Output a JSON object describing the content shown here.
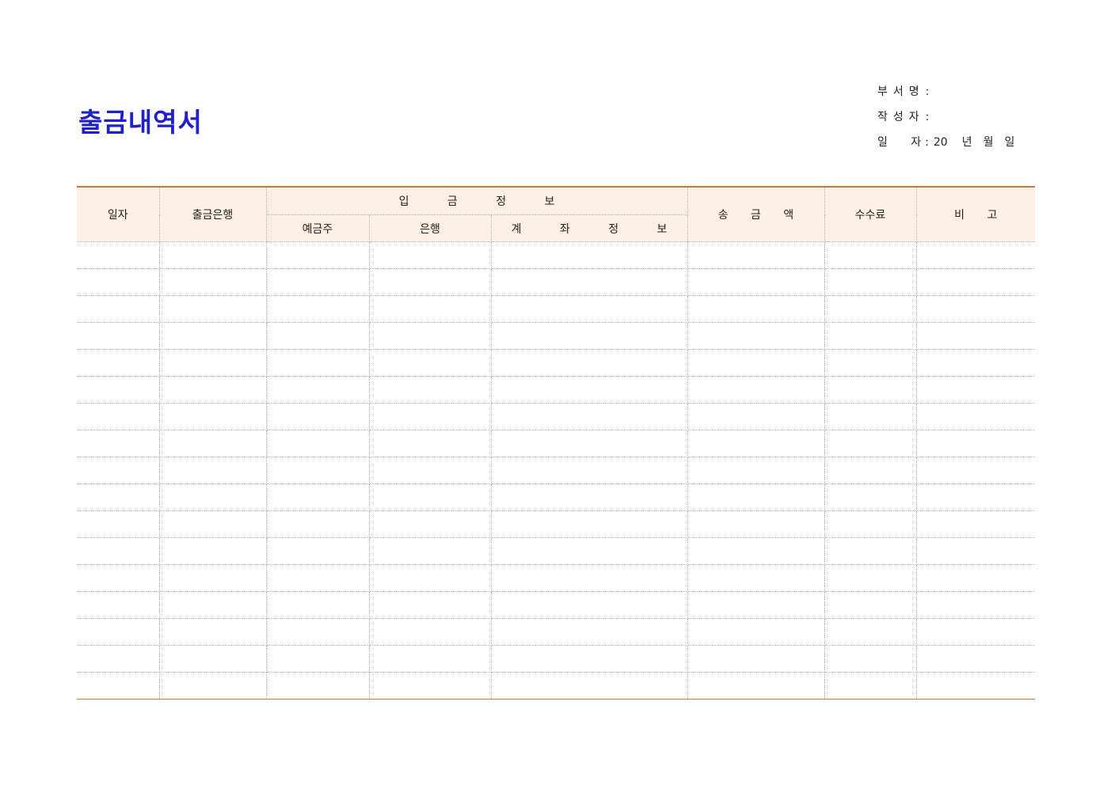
{
  "title": "출금내역서",
  "meta": {
    "department_label": "부서명",
    "author_label": "작성자",
    "date_label": "일   자",
    "colon": ":",
    "date_year": "20",
    "date_year_unit": "년",
    "date_month_unit": "월",
    "date_day_unit": "일"
  },
  "table": {
    "headers": {
      "date": "일자",
      "withdraw_bank": "출금은행",
      "deposit_info": "입 금 정 보",
      "depositor": "예금주",
      "bank": "은행",
      "account_info": "계 좌 정 보",
      "amount": "송 금 액",
      "fee": "수수료",
      "remarks": "비 고"
    },
    "empty_rows": 17
  },
  "colors": {
    "title": "#1f1fcc",
    "accent_line": "#d2742c",
    "header_bg": "#fdf1e7"
  }
}
